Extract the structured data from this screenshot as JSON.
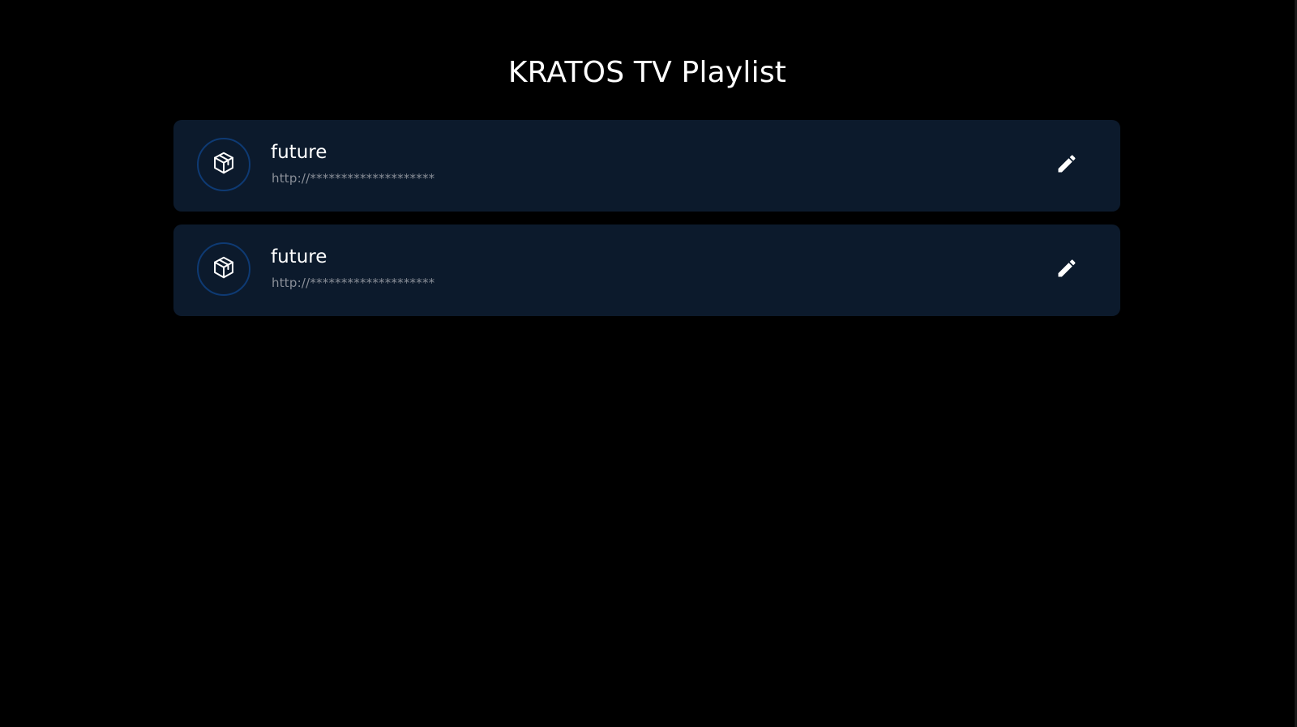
{
  "header": {
    "title": "KRATOS TV Playlist"
  },
  "playlists": [
    {
      "name": "future",
      "url": "http://********************",
      "icon": "package-box-icon",
      "action_icon": "edit-pencil-icon"
    },
    {
      "name": "future",
      "url": "http://********************",
      "icon": "package-box-icon",
      "action_icon": "edit-pencil-icon"
    }
  ],
  "colors": {
    "background": "#000000",
    "card": "#0c1a2c",
    "avatar_ring": "#0e3a73",
    "text_primary": "#ffffff",
    "text_secondary": "#8a8f98"
  }
}
